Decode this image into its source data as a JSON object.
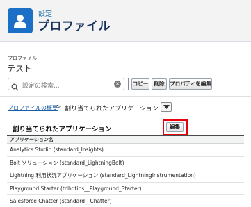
{
  "header": {
    "setup_label": "設定",
    "title": "プロファイル",
    "icon": "user-icon"
  },
  "profile": {
    "type_label": "プロファイル",
    "name": "テスト"
  },
  "toolbar": {
    "search_placeholder": "設定の検索...",
    "copy_label": "コピー",
    "delete_label": "削除",
    "edit_props_label": "プロパティを編集"
  },
  "breadcrumb": {
    "overview_link": "プロファイルの概要",
    "separator": ">",
    "current": "割り当てられたアプリケーション"
  },
  "section": {
    "title": "割り当てられたアプリケーション",
    "edit_label": "編集",
    "highlight_color": "#e8000b"
  },
  "table": {
    "header": "アプリケーション名",
    "rows": [
      "Analytics Studio (standard_Insights)",
      "Bolt ソリューション (standard_LightningBolt)",
      "Lightning 利用状況アプリケーション (standard_LightningInstrumentation)",
      "Playground Starter (trlhdtips__Playground_Starter)",
      "Salesforce Chatter (standard__Chatter)"
    ]
  }
}
